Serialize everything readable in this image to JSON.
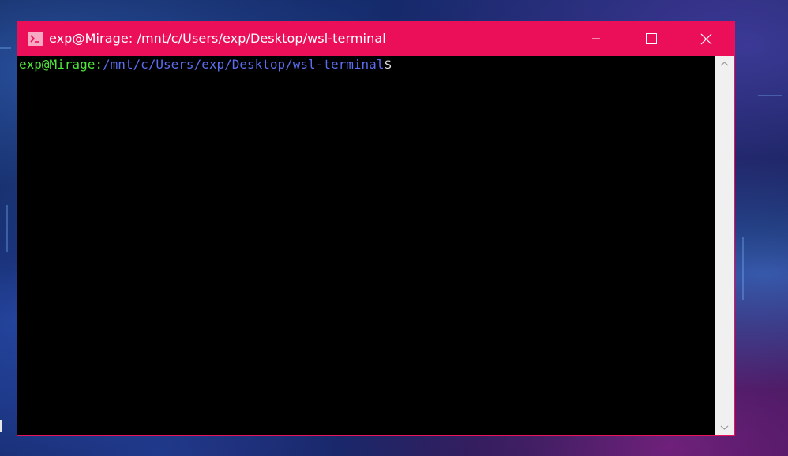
{
  "window": {
    "title": "exp@Mirage: /mnt/c/Users/exp/Desktop/wsl-terminal",
    "icon": "terminal-icon",
    "accent_color": "#eb0f5a"
  },
  "controls": {
    "minimize_icon": "minimize-icon",
    "maximize_icon": "maximize-icon",
    "close_icon": "close-icon"
  },
  "terminal": {
    "user_host": "exp@Mirage",
    "separator": ":",
    "cwd": "/mnt/c/Users/exp/Desktop/wsl-terminal",
    "prompt_symbol": "$",
    "colors": {
      "user_host": "#4fe83a",
      "cwd": "#5b6ef0",
      "background": "#000000"
    }
  },
  "scrollbar": {
    "up_icon": "chevron-up-icon",
    "down_icon": "chevron-down-icon"
  }
}
